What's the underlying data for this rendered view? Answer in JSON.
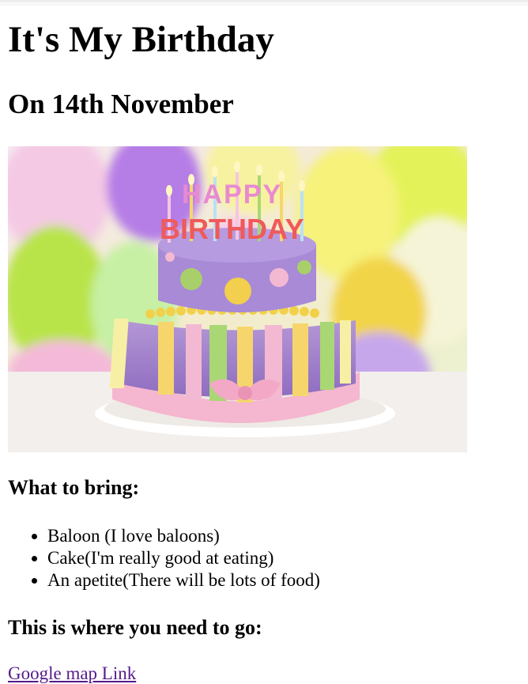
{
  "title": "It's My Birthday",
  "date_heading": "On 14th November",
  "image": {
    "alt": "Birthday cake with HAPPY BIRTHDAY candles",
    "candle_letters_top": "HAPPY",
    "candle_letters_bottom": "BIRTHDAY"
  },
  "bring": {
    "heading": "What to bring:",
    "items": [
      "Baloon (I love baloons)",
      "Cake(I'm really good at eating)",
      "An apetite(There will be lots of food)"
    ]
  },
  "directions": {
    "heading": "This is where you need to go:",
    "link_label": "Google map Link"
  },
  "colors": {
    "link_visited": "#551a8b",
    "text": "#000000",
    "background": "#ffffff"
  }
}
